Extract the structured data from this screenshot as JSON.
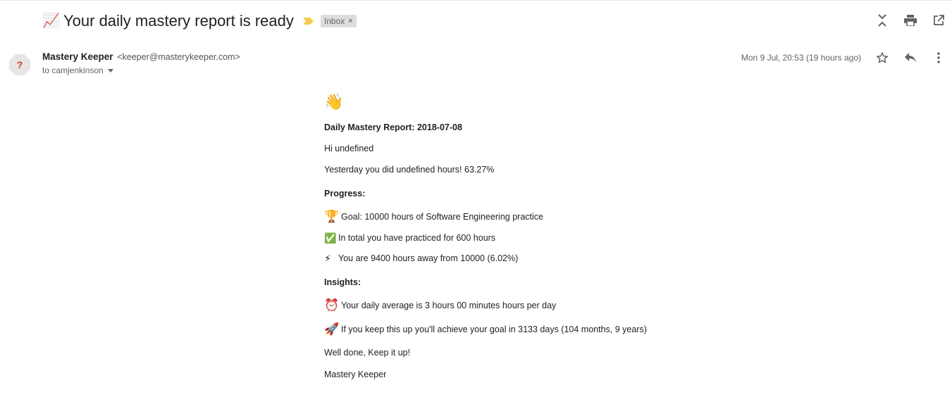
{
  "subject": {
    "emoji": "📈",
    "text": "Your daily mastery report is ready",
    "label_chip": "Inbox",
    "chip_close": "×"
  },
  "sender": {
    "avatar_glyph": "?",
    "name": "Mastery Keeper",
    "email": "<keeper@masterykeeper.com>",
    "to": "to camjenkinson"
  },
  "date": "Mon 9 Jul, 20:53 (19 hours ago)",
  "body": {
    "wave_emoji": "👋",
    "title": "Daily Mastery Report: 2018-07-08",
    "greeting": "Hi undefined",
    "yesterday": "Yesterday you did undefined hours! 63.27%",
    "progress_heading": "Progress:",
    "goal_emoji": "🏆",
    "goal": "Goal: 10000 hours of Software Engineering practice",
    "total_emoji": "✅",
    "total": "In total you have practiced for 600 hours",
    "away_emoji": "⚡",
    "away": "You are 9400 hours away from 10000 (6.02%)",
    "insights_heading": "Insights:",
    "average_emoji": "⏰",
    "average": "Your daily average is 3 hours 00 minutes hours per day",
    "achieve_emoji": "🚀",
    "achieve": "If you keep this up you'll achieve your goal in 3133 days (104 months, 9 years)",
    "well_done": "Well done, Keep it up!",
    "signature": "Mastery Keeper"
  },
  "colors": {
    "importance_marker": "#f7cb4d",
    "chip_bg": "#dddddd",
    "icon": "#5f6368"
  }
}
